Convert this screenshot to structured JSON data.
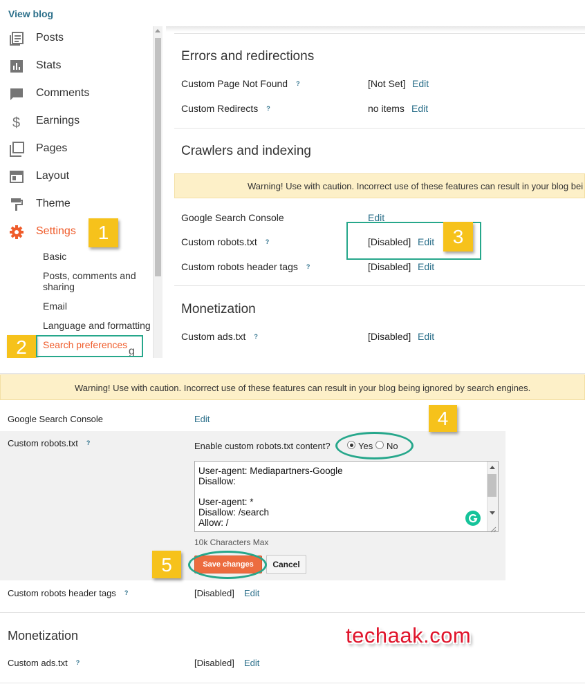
{
  "sidebar": {
    "view_blog": "View blog",
    "items": [
      {
        "label": "Posts",
        "icon": "posts-icon"
      },
      {
        "label": "Stats",
        "icon": "stats-icon"
      },
      {
        "label": "Comments",
        "icon": "comments-icon"
      },
      {
        "label": "Earnings",
        "icon": "dollar-icon"
      },
      {
        "label": "Pages",
        "icon": "pages-icon"
      },
      {
        "label": "Layout",
        "icon": "layout-icon"
      },
      {
        "label": "Theme",
        "icon": "paint-roller-icon"
      },
      {
        "label": "Settings",
        "icon": "gear-icon"
      }
    ],
    "sub_items": [
      {
        "label": "Basic"
      },
      {
        "label": "Posts, comments and sharing"
      },
      {
        "label": "Email"
      },
      {
        "label": "Language and formatting"
      },
      {
        "label": "Search preferences"
      }
    ],
    "accent_color": "#ef5b2a"
  },
  "top": {
    "errors": {
      "title": "Errors and redirections",
      "rows": [
        {
          "label": "Custom Page Not Found",
          "help": "?",
          "value": "[Not Set]",
          "edit": "Edit"
        },
        {
          "label": "Custom Redirects",
          "help": "?",
          "value": "no items",
          "edit": "Edit"
        }
      ]
    },
    "crawlers": {
      "title": "Crawlers and indexing",
      "warning": "Warning! Use with caution. Incorrect use of these features can result in your blog bei",
      "rows": [
        {
          "label": "Google Search Console",
          "help": "",
          "value": "",
          "edit": "Edit"
        },
        {
          "label": "Custom robots.txt",
          "help": "?",
          "value": "[Disabled]",
          "edit": "Edit"
        },
        {
          "label": "Custom robots header tags",
          "help": "?",
          "value": "[Disabled]",
          "edit": "Edit"
        }
      ]
    },
    "monetization": {
      "title": "Monetization",
      "rows": [
        {
          "label": "Custom ads.txt",
          "help": "?",
          "value": "[Disabled]",
          "edit": "Edit"
        }
      ]
    },
    "cutoff_text": "g"
  },
  "bottom": {
    "warning": "Warning! Use with caution. Incorrect use of these features can result in your blog being ignored by search engines.",
    "gsc": {
      "label": "Google Search Console",
      "edit": "Edit"
    },
    "robots": {
      "label": "Custom robots.txt",
      "help": "?",
      "enable_label": "Enable custom robots.txt content?",
      "yes": "Yes",
      "no": "No",
      "selected": "Yes",
      "content": "User-agent: Mediapartners-Google\nDisallow:\n\nUser-agent: *\nDisallow: /search\nAllow: /",
      "char_limit": "10k Characters Max",
      "save": "Save changes",
      "cancel": "Cancel"
    },
    "header_tags": {
      "label": "Custom robots header tags",
      "help": "?",
      "value": "[Disabled]",
      "edit": "Edit"
    },
    "monetization": {
      "title": "Monetization",
      "ads": {
        "label": "Custom ads.txt",
        "help": "?",
        "value": "[Disabled]",
        "edit": "Edit"
      }
    }
  },
  "annotations": {
    "steps": [
      "1",
      "2",
      "3",
      "4",
      "5"
    ],
    "badge_color": "#f6c21b",
    "highlight_color": "#26a78b"
  },
  "watermark": "techaak.com"
}
